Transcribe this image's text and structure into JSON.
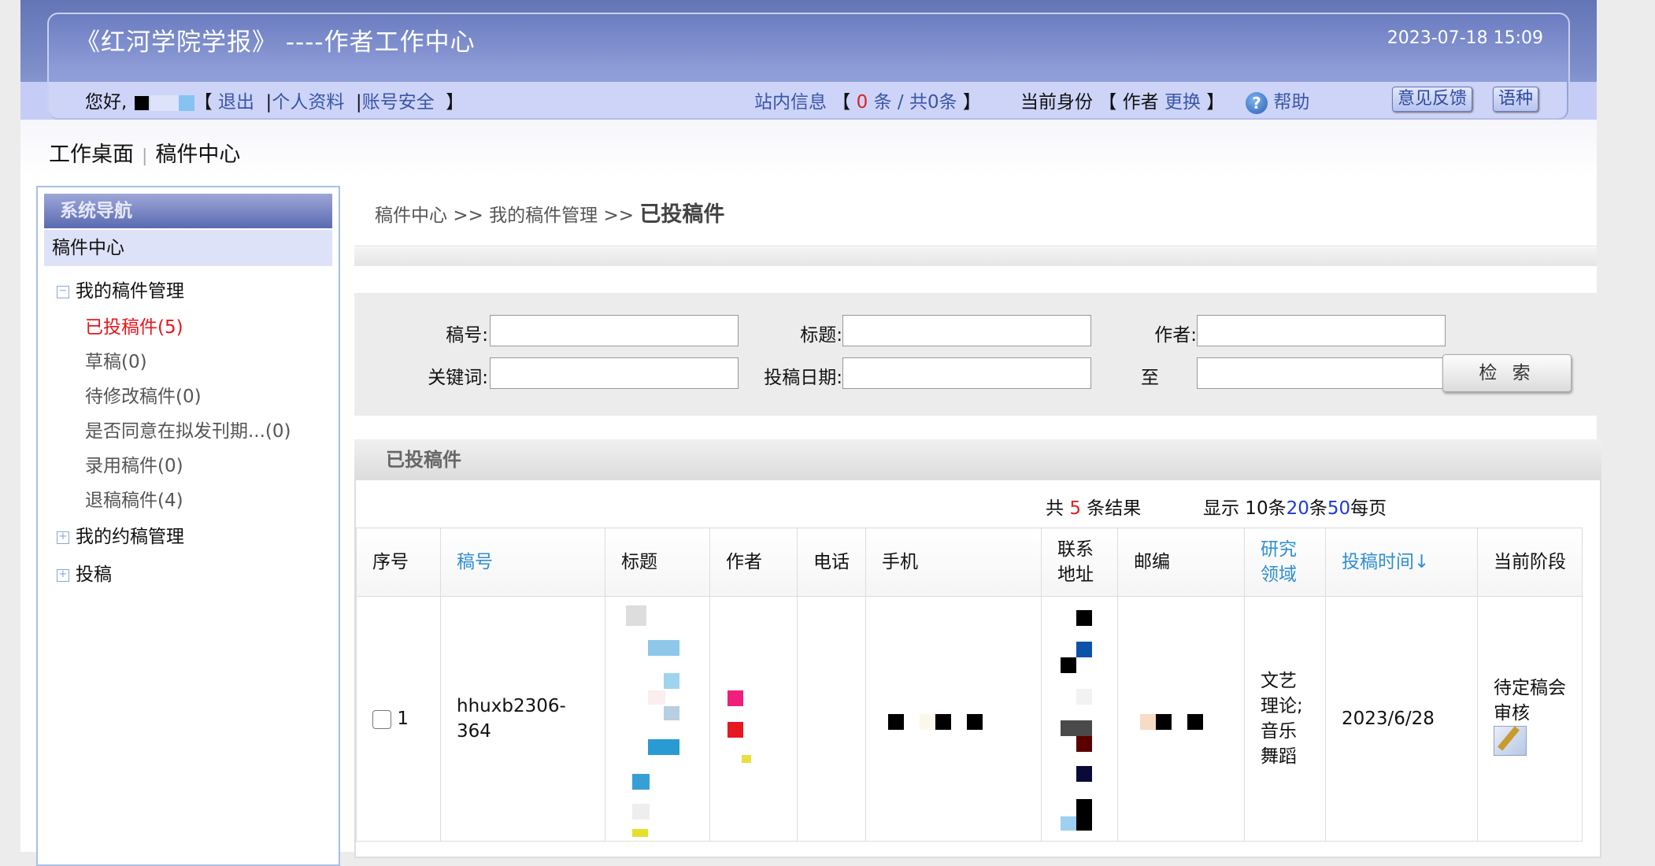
{
  "header": {
    "title": "《红河学院学报》 ----作者工作中心",
    "datetime": "2023-07-18 15:09",
    "greeting": "您好,",
    "links": {
      "logout": "退出",
      "profile": "个人资料",
      "security": "账号安全"
    },
    "messages_label": "站内信息",
    "messages_unread": "0",
    "messages_tail": "条 / 共0条",
    "identity_label": "当前身份",
    "identity_role": "作者",
    "identity_switch": "更换",
    "help": "帮助",
    "feedback_button": "意见反馈",
    "language_button": "语种"
  },
  "topnav": {
    "desk": "工作桌面",
    "center": "稿件中心"
  },
  "sidebar": {
    "heading": "系统导航",
    "section": "稿件中心",
    "groups": [
      {
        "label": "我的稿件管理",
        "expanded": true,
        "items": [
          "已投稿件(5)",
          "草稿(0)",
          "待修改稿件(0)",
          "是否同意在拟发刊期...(0)",
          "录用稿件(0)",
          "退稿稿件(4)"
        ]
      },
      {
        "label": "我的约稿管理",
        "expanded": false
      },
      {
        "label": "投稿",
        "expanded": false
      }
    ]
  },
  "breadcrumb": {
    "level1": "稿件中心",
    "level2": "我的稿件管理",
    "current": "已投稿件",
    "sep": ">>"
  },
  "search": {
    "manuscript_no_label": "稿号:",
    "title_label": "标题:",
    "author_label": "作者:",
    "keyword_label": "关键词:",
    "date_label": "投稿日期:",
    "to_label": "至",
    "search_button": "检 索"
  },
  "results": {
    "panel_title": "已投稿件",
    "total_prefix": "共",
    "total": "5",
    "total_suffix": "条结果",
    "page_size_prefix": "显示 10条",
    "page_size_20": "20",
    "mid": "条",
    "page_size_50": "50",
    "page_size_suffix": "每页",
    "columns": [
      "序号",
      "稿号",
      "标题",
      "作者",
      "电话",
      "手机",
      "联系地址",
      "邮编",
      "研究领域",
      "投稿时间↓",
      "当前阶段"
    ],
    "rows": [
      {
        "index": "1",
        "manuscript_no": "hhuxb2306-364",
        "field": "文艺理论;音乐舞蹈",
        "submitted": "2023/6/28",
        "stage": "待定稿会审核"
      }
    ]
  },
  "colors": {
    "header_blue": "#6b7cc0",
    "active_red": "#e8161c",
    "sort_link": "#2f8fd1"
  }
}
